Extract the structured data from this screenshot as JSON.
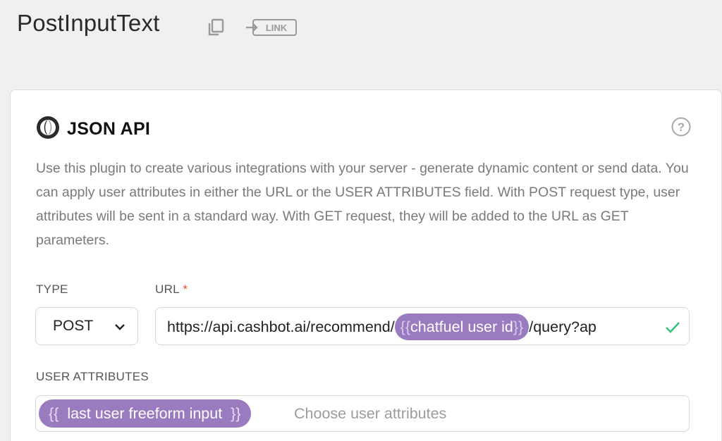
{
  "header": {
    "block_title": "PostInputText",
    "link_label": "LINK"
  },
  "plugin": {
    "title": "JSON API",
    "description": "Use this plugin to create various integrations with your server - generate dynamic content or send data. You can apply user attributes in either the URL or the USER ATTRIBUTES field. With POST request type, user attributes will be sent in a standard way. With GET request, they will be added to the URL as GET parameters."
  },
  "form": {
    "type_label": "TYPE",
    "type_value": "POST",
    "url_label": "URL",
    "url_required_mark": "*",
    "url_prefix": "https://api.cashbot.ai/recommend/",
    "url_chip_open": "{{",
    "url_chip_name": "chatfuel user id",
    "url_chip_close": "}}",
    "url_suffix": "/query?ap",
    "attributes_label": "USER ATTRIBUTES",
    "attribute_chip_open": "{{",
    "attribute_chip_name": "last user freeform input",
    "attribute_chip_close": "}}",
    "attributes_placeholder": "Choose user attributes"
  },
  "icons": {
    "copy": "copy-icon",
    "link": "link-icon",
    "logo": "json-logo-icon",
    "help": "help-icon",
    "chevron": "chevron-down-icon",
    "check": "check-icon"
  },
  "colors": {
    "chip": "#9a7bbf",
    "required": "#e24e2a",
    "check": "#3cbf7a",
    "text_muted": "#7a7a7a"
  }
}
